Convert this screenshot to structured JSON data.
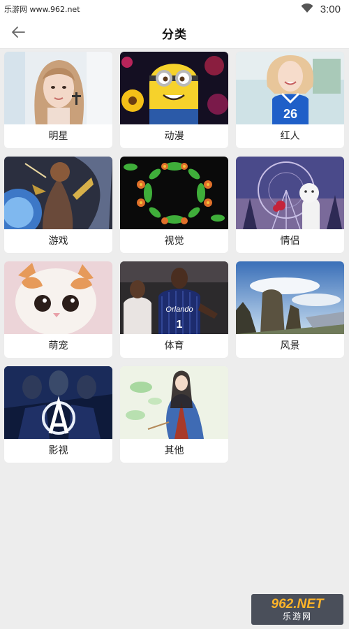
{
  "status_bar": {
    "site_text": "乐游网 www.962.net",
    "time": "3:00",
    "icons": [
      "wifi-icon",
      "signal-icon"
    ]
  },
  "header": {
    "back_icon": "arrow-left-icon",
    "title": "分类"
  },
  "categories": [
    {
      "label": "明星",
      "icon": "portrait-photo"
    },
    {
      "label": "动漫",
      "icon": "minion-cartoon"
    },
    {
      "label": "红人",
      "icon": "girl-jersey-photo"
    },
    {
      "label": "游戏",
      "icon": "game-character"
    },
    {
      "label": "视觉",
      "icon": "flower-pattern"
    },
    {
      "label": "情侣",
      "icon": "ferris-wheel-bear"
    },
    {
      "label": "萌宠",
      "icon": "kitten-photo"
    },
    {
      "label": "体育",
      "icon": "basketball-players"
    },
    {
      "label": "风景",
      "icon": "mountain-landscape"
    },
    {
      "label": "影视",
      "icon": "avengers-poster"
    },
    {
      "label": "其他",
      "icon": "ancient-woman-painting"
    }
  ],
  "watermark": {
    "top": "962.NET",
    "bottom": "乐游网"
  },
  "colors": {
    "background": "#ededed",
    "card": "#ffffff",
    "watermark_bg": "#4a4f5a",
    "watermark_accent": "#ffb428"
  }
}
